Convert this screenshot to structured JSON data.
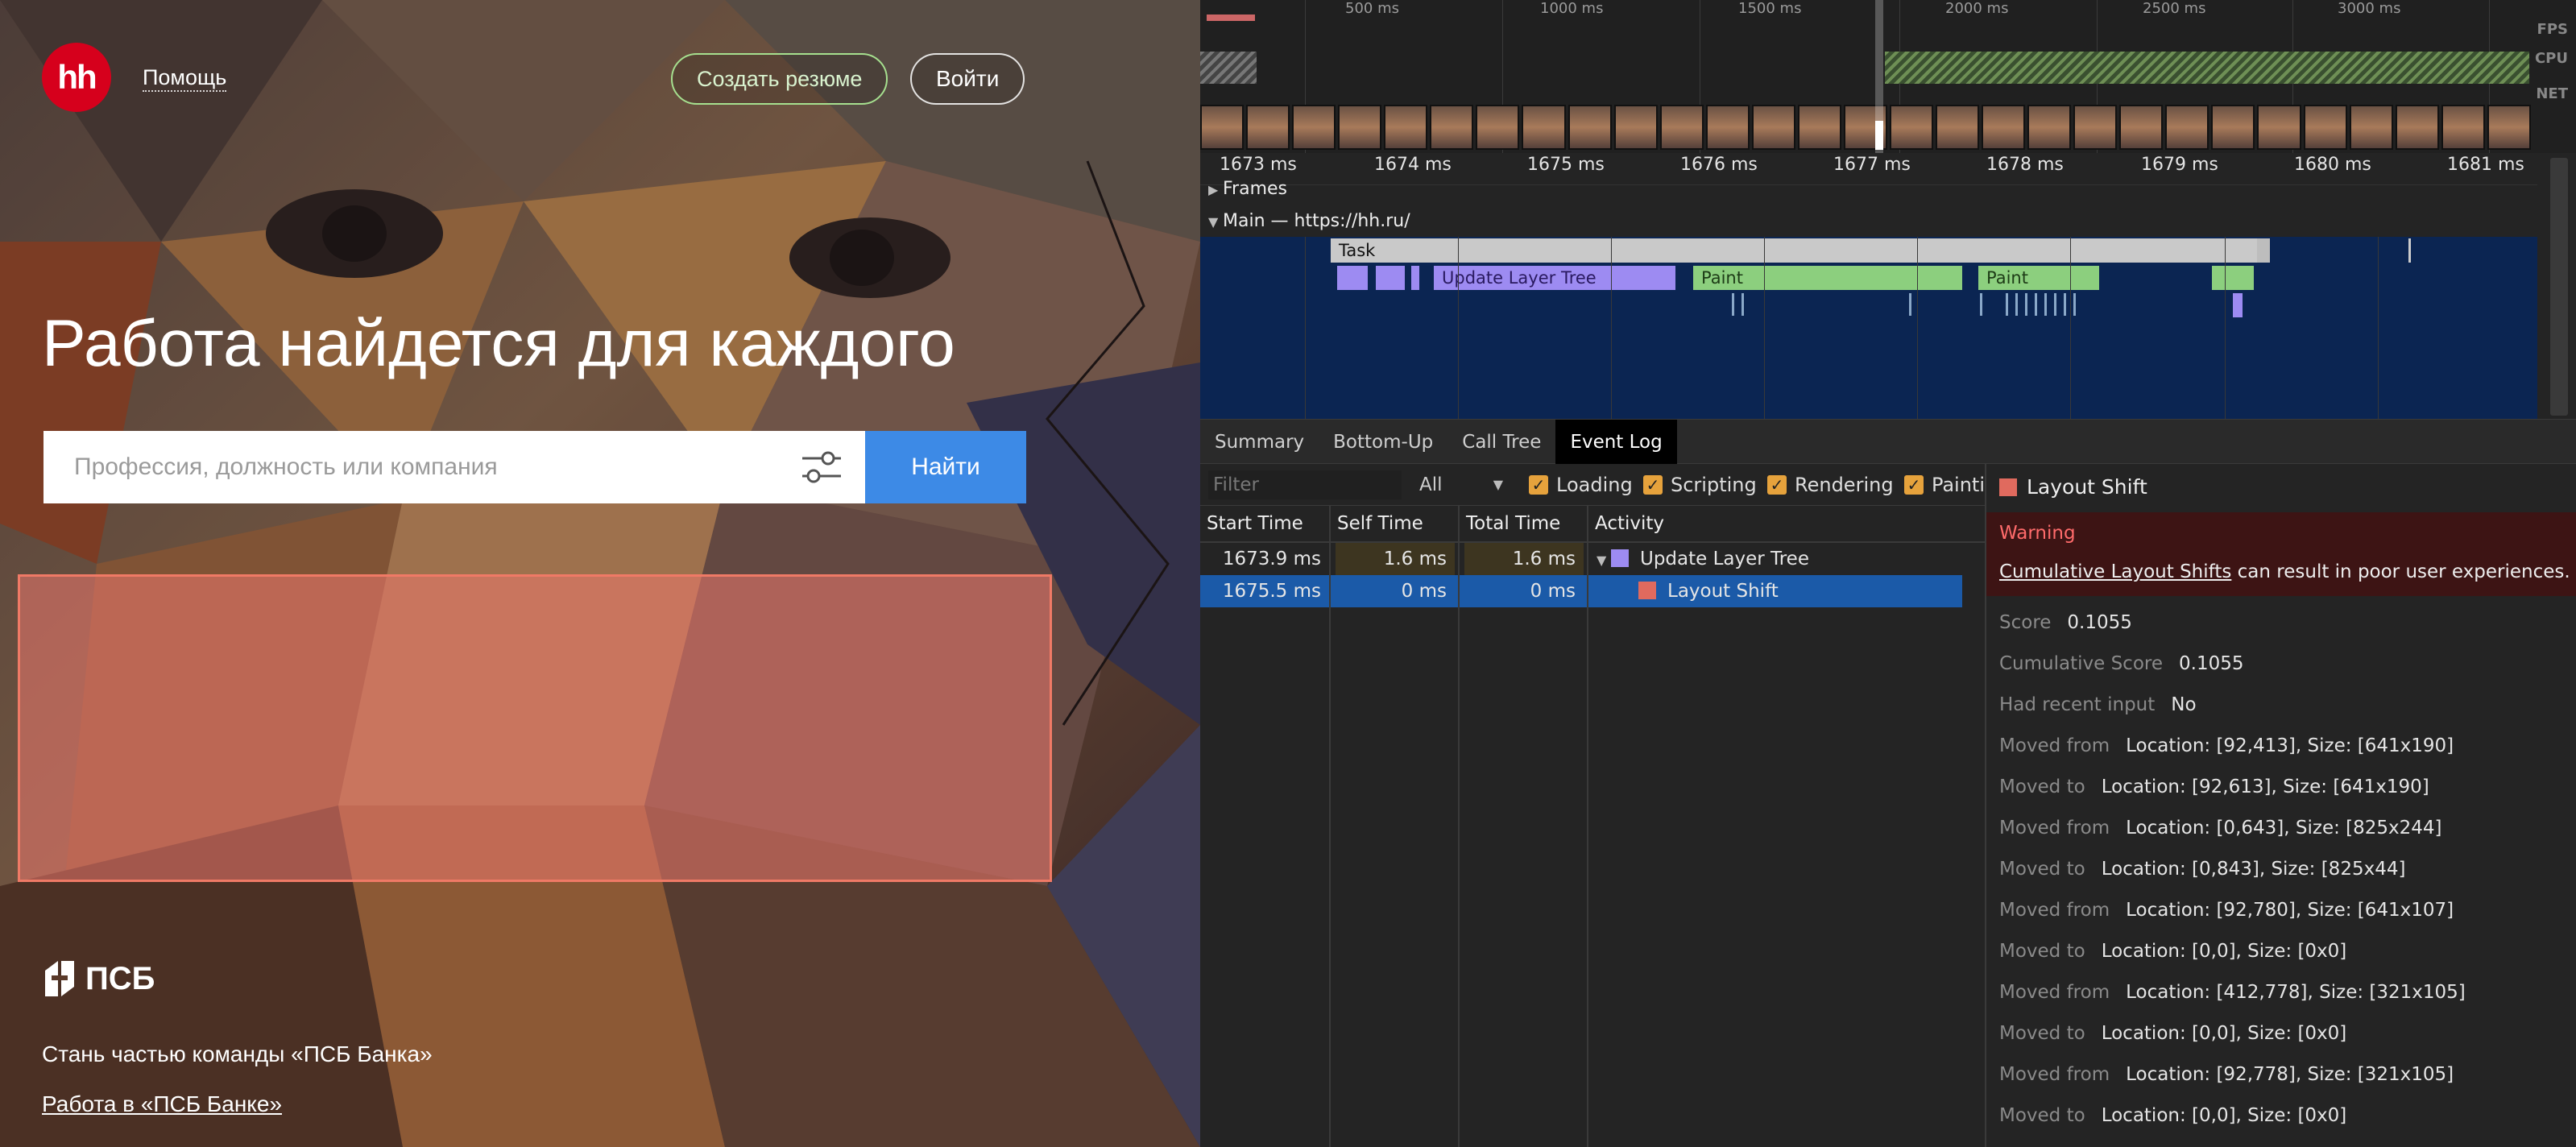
{
  "site": {
    "logo": "hh",
    "help": "Помощь",
    "create_resume": "Создать резюме",
    "login": "Войти",
    "hero_title": "Работа найдется для каждого",
    "search": {
      "placeholder": "Профессия, должность или компания",
      "button": "Найти"
    },
    "promo": {
      "brand": "ПСБ",
      "line1": "Стань частью команды «ПСБ Банка»",
      "line2": "Работа в «ПСБ Банке»"
    },
    "colors": {
      "brand_red": "#d6001c",
      "search_blue": "#3d8ae6",
      "shift_highlight": "#ec786e"
    }
  },
  "devtools": {
    "overview": {
      "ticks": [
        "500 ms",
        "1000 ms",
        "1500 ms",
        "2000 ms",
        "2500 ms",
        "3000 ms"
      ],
      "lanes": [
        "FPS",
        "CPU",
        "NET"
      ]
    },
    "ruler_ticks": [
      "1673 ms",
      "1674 ms",
      "1675 ms",
      "1676 ms",
      "1677 ms",
      "1678 ms",
      "1679 ms",
      "1680 ms",
      "1681 ms"
    ],
    "tracks": {
      "frames": "Frames",
      "main": "Main — https://hh.ru/"
    },
    "flame": {
      "task": "Task",
      "update_layer_tree": "Update Layer Tree",
      "paint1": "Paint",
      "paint2": "Paint"
    },
    "tabs": [
      "Summary",
      "Bottom-Up",
      "Call Tree",
      "Event Log"
    ],
    "active_tab": "Event Log",
    "filter": {
      "placeholder": "Filter",
      "category": "All",
      "checkboxes": [
        "Loading",
        "Scripting",
        "Rendering",
        "Painti"
      ]
    },
    "table": {
      "headers": [
        "Start Time",
        "Self Time",
        "Total Time",
        "Activity"
      ],
      "rows": [
        {
          "start": "1673.9 ms",
          "self": "1.6 ms",
          "total": "1.6 ms",
          "activity": "Update Layer Tree",
          "color": "#9d8bf2"
        },
        {
          "start": "1675.5 ms",
          "self": "0 ms",
          "total": "0 ms",
          "activity": "Layout Shift",
          "color": "#e06a5e"
        }
      ]
    },
    "details": {
      "title": "Layout Shift",
      "warning": "Warning",
      "warning_link": "Cumulative Layout Shifts",
      "warning_text": " can result in poor user experiences.",
      "rows": [
        {
          "k": "Score",
          "v": "0.1055"
        },
        {
          "k": "Cumulative Score",
          "v": "0.1055"
        },
        {
          "k": "Had recent input",
          "v": "No"
        },
        {
          "k": "Moved from",
          "v": "Location: [92,413], Size: [641x190]"
        },
        {
          "k": "Moved to",
          "v": "Location: [92,613], Size: [641x190]"
        },
        {
          "k": "Moved from",
          "v": "Location: [0,643], Size: [825x244]"
        },
        {
          "k": "Moved to",
          "v": "Location: [0,843], Size: [825x44]"
        },
        {
          "k": "Moved from",
          "v": "Location: [92,780], Size: [641x107]"
        },
        {
          "k": "Moved to",
          "v": "Location: [0,0], Size: [0x0]"
        },
        {
          "k": "Moved from",
          "v": "Location: [412,778], Size: [321x105]"
        },
        {
          "k": "Moved to",
          "v": "Location: [0,0], Size: [0x0]"
        },
        {
          "k": "Moved from",
          "v": "Location: [92,778], Size: [321x105]"
        },
        {
          "k": "Moved to",
          "v": "Location: [0,0], Size: [0x0]"
        }
      ]
    }
  }
}
